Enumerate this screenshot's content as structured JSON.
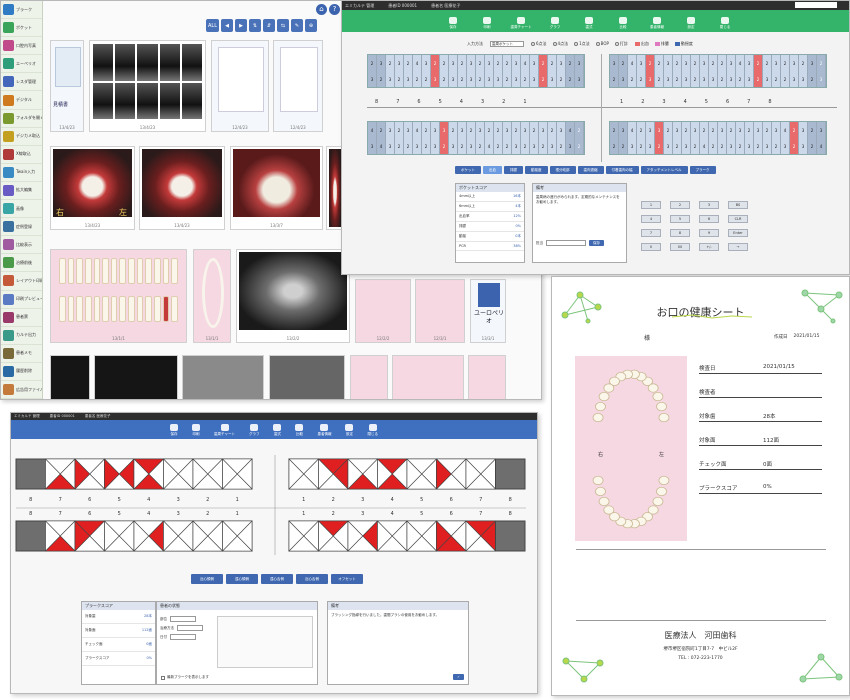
{
  "colors": {
    "brand_green": "#34b36a",
    "brand_blue": "#3f6fbf",
    "mark_red": "#e02020",
    "pink_panel": "#f6d8e2"
  },
  "panel1": {
    "sidebar_items": [
      {
        "label": "ブラーク",
        "color": "#2f7bc4"
      },
      {
        "label": "ポケット",
        "color": "#3aa55a"
      },
      {
        "label": "口腔内写真",
        "color": "#c04a8a"
      },
      {
        "label": "エーペリオ",
        "color": "#2e9d7a"
      },
      {
        "label": "レスダ管理",
        "color": "#4466bb"
      },
      {
        "label": "デジタル",
        "color": "#d07a20"
      },
      {
        "label": "フォルダを開く",
        "color": "#7a9a30"
      },
      {
        "label": "デジカメ取込",
        "color": "#c4a020"
      },
      {
        "label": "X線取込",
        "color": "#b03a3a"
      },
      {
        "label": "Twain入力",
        "color": "#3a8ac4"
      },
      {
        "label": "拡大編集",
        "color": "#6a5ac4"
      },
      {
        "label": "画像",
        "color": "#3aa5a5"
      },
      {
        "label": "症例登録",
        "color": "#3a70a0"
      },
      {
        "label": "比較表示",
        "color": "#a05aa0"
      },
      {
        "label": "治療前後",
        "color": "#4a9a4a"
      },
      {
        "label": "レイアウト印刷",
        "color": "#c45a3a"
      },
      {
        "label": "印刷プレビュー",
        "color": "#5a7ac4"
      },
      {
        "label": "患者票",
        "color": "#9a3a6a"
      },
      {
        "label": "カルテ出力",
        "color": "#3a9a8a"
      },
      {
        "label": "患者メモ",
        "color": "#7a6a3a"
      },
      {
        "label": "履歴削除",
        "color": "#2a6aa4"
      },
      {
        "label": "広告用ファイル",
        "color": "#c47a3a"
      }
    ],
    "toolbar": [
      "ALL",
      "◀",
      "▶",
      "⇅",
      "⇵",
      "⇆",
      "✎",
      "⊕"
    ],
    "captions": [
      "13/4/23",
      "13/4/23",
      "12/4/23",
      "12/4/23",
      "13/4/23",
      "13/4/23",
      "13/3/7",
      "13/1/1",
      "13/1/1",
      "13/2/2",
      "12/2/2",
      "12/3/1",
      "13/3/1"
    ],
    "doc_label": "見積書",
    "perio_label": "ユーロペリオ",
    "photo_marks": {
      "right": "右",
      "left": "左"
    }
  },
  "panel2": {
    "title_segments": [
      "エミカルテ 管理",
      "患者ID 000001",
      "患者名 医療花子"
    ],
    "toolbar": [
      "保存",
      "印刷",
      "歯周チャート",
      "グラフ",
      "歯式",
      "比較",
      "患者情報",
      "設定",
      "閉じる"
    ],
    "options": {
      "select_label": "入力方法",
      "select_value": "歯周ポケット",
      "radios": [
        "6点法",
        "4点法",
        "1点法",
        "BOP",
        "打診"
      ],
      "legend": [
        "出血",
        "排膿",
        "動揺度"
      ]
    },
    "upper_rows": [
      [
        "2",
        "3",
        "2",
        "3",
        "2",
        "4",
        "3",
        "2",
        "2",
        "3",
        "2",
        "3",
        "2",
        "3",
        "2",
        "2",
        "3",
        "4",
        "3",
        "2",
        "2",
        "3",
        "2",
        "3",
        "2",
        "3",
        "2",
        "3",
        "2",
        "3"
      ],
      [
        "3",
        "2",
        "3",
        "2",
        "3",
        "2",
        "2",
        "3",
        "2",
        "3",
        "2",
        "3",
        "2",
        "3",
        "3",
        "2",
        "3",
        "2",
        "3",
        "2",
        "3",
        "2",
        "2",
        "3",
        "3",
        "2",
        "3",
        "2",
        "3",
        "2"
      ]
    ],
    "lower_rows": [
      [
        "4",
        "2",
        "3",
        "2",
        "3",
        "4",
        "2",
        "3",
        "3",
        "2",
        "3",
        "2",
        "3",
        "2",
        "2",
        "3",
        "2",
        "3",
        "2",
        "3",
        "2",
        "3",
        "4",
        "2",
        "3",
        "2",
        "3",
        "2",
        "3",
        "2"
      ],
      [
        "3",
        "4",
        "3",
        "2",
        "2",
        "3",
        "2",
        "3",
        "2",
        "3",
        "2",
        "3",
        "2",
        "4",
        "2",
        "2",
        "3",
        "2",
        "3",
        "2",
        "3",
        "2",
        "3",
        "2",
        "3",
        "2",
        "4",
        "3",
        "2",
        "3"
      ]
    ],
    "tooth_nums_left": [
      "8",
      "7",
      "6",
      "5",
      "4",
      "3",
      "2",
      "1"
    ],
    "tooth_nums_right": [
      "1",
      "2",
      "3",
      "4",
      "5",
      "6",
      "7",
      "8"
    ],
    "tabs": [
      "ポケット",
      "出血",
      "排膿",
      "動揺度",
      "根分岐部",
      "歯肉退縮",
      "付着歯肉の幅",
      "アタッチメントレベル",
      "プラーク"
    ],
    "score_box": {
      "title": "ポケットスコア",
      "rows": [
        [
          "4mm以上",
          "16本"
        ],
        [
          "6mm以上",
          "4本"
        ],
        [
          "出血率",
          "12%"
        ],
        [
          "排膿",
          "0%"
        ],
        [
          "動揺",
          "0本"
        ],
        [
          "PCR",
          "38%"
        ]
      ]
    },
    "memo_box": {
      "title": "備考",
      "text": "歯周病の進行がみられます。定期的なメンテナンスをお勧めします。",
      "select_label": "担当",
      "save": "保存"
    },
    "keypad": [
      "1",
      "2",
      "3",
      "BS",
      "4",
      "5",
      "6",
      "CLR",
      "7",
      "8",
      "9",
      "Enter",
      "0",
      "00",
      "+/-",
      "→"
    ]
  },
  "panel3": {
    "title_segments": [
      "エミカルテ 管理",
      "患者ID 000001",
      "患者名 医療花子"
    ],
    "toolbar": [
      "保存",
      "印刷",
      "歯周チャート",
      "グラフ",
      "歯式",
      "比較",
      "患者情報",
      "設定",
      "閉じる"
    ],
    "upper_nums": [
      "8",
      "7",
      "6",
      "5",
      "4",
      "3",
      "2",
      "1",
      "1",
      "2",
      "3",
      "4",
      "5",
      "6",
      "7",
      "8"
    ],
    "lower_nums": [
      "8",
      "7",
      "6",
      "5",
      "4",
      "3",
      "2",
      "1",
      "1",
      "2",
      "3",
      "4",
      "5",
      "6",
      "7",
      "8"
    ],
    "tabs": [
      "近心頬側",
      "遠心頬側",
      "遠心舌側",
      "近心舌側",
      "オフセット"
    ],
    "score_box": {
      "title": "プラークスコア",
      "rows": [
        [
          "対象歯",
          "28本"
        ],
        [
          "対象面",
          "112面"
        ],
        [
          "チェック面",
          "0面"
        ],
        [
          "プラークスコア",
          "0%"
        ]
      ]
    },
    "input_box": {
      "title": "患者の状態",
      "fields": [
        "部位",
        "治療方法",
        "日付"
      ],
      "check": "最新プラークを表示します"
    },
    "memo_box": {
      "title": "備考",
      "text": "ブラッシング指導を行いました。歯間ブラシの使用をお勧めします。"
    }
  },
  "panel4": {
    "title": "お口の健康シート",
    "honorific": "様",
    "created_label": "作成日",
    "created_date": "2021/01/15",
    "left_mark": "右",
    "right_mark": "左",
    "rows": [
      [
        "検査日",
        "2021/01/15"
      ],
      [
        "検査者",
        ""
      ],
      [
        "対象歯",
        "28本"
      ],
      [
        "対象面",
        "112面"
      ],
      [
        "チェック面",
        "0面"
      ],
      [
        "プラークスコア",
        "0%"
      ]
    ],
    "clinic_name": "医療法人　河田歯科",
    "address": "堺市堺区宿院町1丁目7-7　中ビル2F",
    "tel": "TEL : 072-223-1770"
  }
}
